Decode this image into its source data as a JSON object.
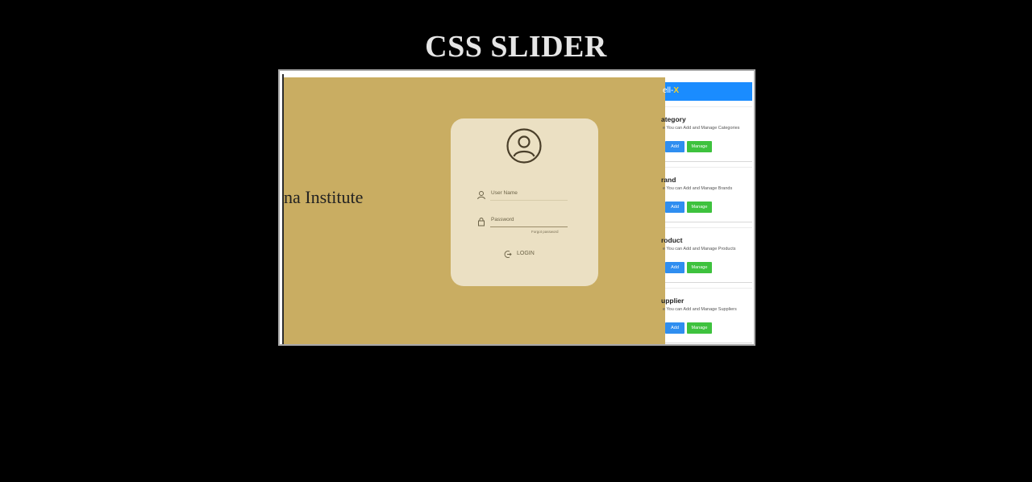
{
  "page": {
    "title": "CSS SLIDER"
  },
  "slides": {
    "login": {
      "institute_text": "na Institute",
      "username_label": "User Name",
      "password_label": "Password",
      "forgot_text": "Forgot password",
      "login_label": "LOGIN",
      "colors": {
        "background": "#c9ad62",
        "card": "#ebe0c3"
      }
    },
    "dashboard": {
      "brand_prefix": "ell-",
      "brand_accent": "X",
      "cards": [
        {
          "title": "ategory",
          "desc": "e You can Add and Manage Categories",
          "add": "Add",
          "manage": "Manage"
        },
        {
          "title": "rand",
          "desc": "e You can Add and Manage Brands",
          "add": "Add",
          "manage": "Manage"
        },
        {
          "title": "roduct",
          "desc": "e You can Add and Manage Products",
          "add": "Add",
          "manage": "Manage"
        },
        {
          "title": "upplier",
          "desc": "e You can Add and Manage Suppliers",
          "add": "Add",
          "manage": "Manage"
        }
      ],
      "colors": {
        "appbar": "#1a8cff",
        "add": "#2f8ef0",
        "manage": "#3ec23e"
      }
    }
  }
}
